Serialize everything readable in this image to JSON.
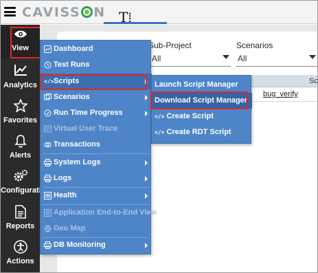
{
  "header": {
    "brand": "CAVISS",
    "brand_suffix": "N",
    "caret": "T⁞"
  },
  "sidebar": {
    "items": [
      {
        "label": "View",
        "icon": "eye-icon"
      },
      {
        "label": "Analytics",
        "icon": "line-chart-icon"
      },
      {
        "label": "Favorites",
        "icon": "star-icon"
      },
      {
        "label": "Alerts",
        "icon": "bell-icon"
      },
      {
        "label": "Configuratio",
        "icon": "gears-icon"
      },
      {
        "label": "Reports",
        "icon": "document-icon"
      },
      {
        "label": "Actions",
        "icon": "accessibility-icon"
      }
    ]
  },
  "main": {
    "subproject_label": "Sub-Project",
    "subproject_value": "All",
    "scenarios_label": "Scenarios",
    "scenarios_value": "All",
    "grid_header_col": "Sc",
    "grid_row_link": "bug_verify"
  },
  "menu": {
    "items": [
      {
        "label": "Dashboard",
        "icon": "dashboard-icon"
      },
      {
        "label": "Test Runs",
        "icon": "history-icon"
      },
      {
        "label": "Scripts",
        "icon": "code-icon",
        "submenu": true
      },
      {
        "label": "Scenarios",
        "icon": "scenarios-icon",
        "submenu": true
      },
      {
        "label": "Run Time Progress",
        "icon": "progress-icon",
        "submenu": true
      },
      {
        "label": "Virtual User Trace",
        "icon": "trace-icon",
        "disabled": true
      },
      {
        "label": "Transactions",
        "icon": "transactions-icon"
      },
      {
        "label": "System Logs",
        "icon": "printer-icon",
        "submenu": true
      },
      {
        "label": "Logs",
        "icon": "printer-icon",
        "submenu": true
      },
      {
        "label": "Health",
        "icon": "health-icon",
        "submenu": true
      },
      {
        "label": "Application End-to-End View",
        "icon": "e2e-icon",
        "disabled": true
      },
      {
        "label": "Geo Map",
        "icon": "globe-icon",
        "disabled": true
      },
      {
        "label": "DB Monitoring",
        "icon": "printer-icon",
        "submenu": true
      }
    ]
  },
  "submenu": {
    "items": [
      {
        "label": "Launch Script Manager"
      },
      {
        "label": "Download Script Manager",
        "selected": true
      },
      {
        "label": "Create Script",
        "prefix": "</>"
      },
      {
        "label": "Create RDT Script",
        "prefix": "</>"
      }
    ]
  },
  "colors": {
    "menu_bg": "#4e85c8",
    "sidebar_bg": "#2b2b2b",
    "highlight_border": "#e0262b",
    "brand_green": "#2e9e5a"
  }
}
